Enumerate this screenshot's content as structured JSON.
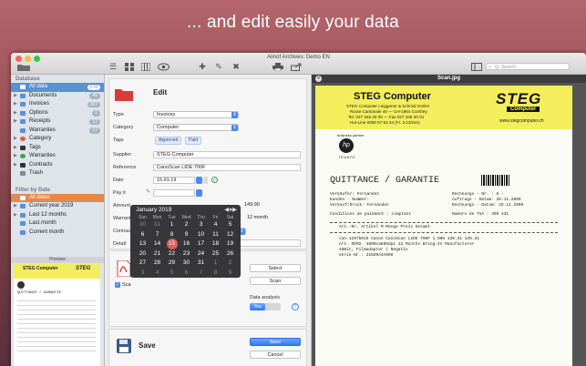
{
  "hero_text": "... and edit easily your data",
  "window": {
    "title": "Alinof Archives: Demo EN"
  },
  "toolbar": {
    "search_placeholder": "Q- Search"
  },
  "sidebar": {
    "database_title": "Database",
    "items": [
      {
        "label": "All data",
        "count": "278",
        "color": "#5b8fd6"
      },
      {
        "label": "Documents",
        "count": "45",
        "color": "#5b8fd6"
      },
      {
        "label": "Invoices",
        "count": "167",
        "color": "#5b8fd6"
      },
      {
        "label": "Options",
        "count": "1",
        "color": "#5b8fd6"
      },
      {
        "label": "Receipts",
        "count": "17",
        "color": "#5b8fd6"
      },
      {
        "label": "Warranties",
        "count": "17",
        "color": "#5b8fd6"
      },
      {
        "label": "Category",
        "count": "",
        "color": "#e25b3a"
      },
      {
        "label": "Tags",
        "count": "",
        "color": "#333"
      },
      {
        "label": "Warranties",
        "count": "",
        "color": "#38a24a"
      },
      {
        "label": "Contracts",
        "count": "",
        "color": "#333"
      },
      {
        "label": "Trash",
        "count": "",
        "color": "#888"
      }
    ],
    "filter_title": "Filter by Date",
    "filter_items": [
      "All dates",
      "Current year 2019",
      "Last 12 months",
      "Last month",
      "Current month"
    ],
    "preview_label": "Preview"
  },
  "edit": {
    "title": "Edit",
    "type_label": "Type",
    "type_value": "Invoices",
    "category_label": "Category",
    "category_value": "Computer",
    "tags_label": "Tags",
    "tags": [
      "Approved",
      "Paid"
    ],
    "supplier_label": "Supplier",
    "supplier_value": "STEG Computer",
    "reference_label": "Reference",
    "reference_value": "CanoScan LIDE 700F",
    "date_label": "Date",
    "date_value": "15.01.19",
    "payit_label": "Pay it",
    "amount_label": "Amount",
    "amount_value": "149.90",
    "warranty_label": "Warrant",
    "warranty_value": "12 month",
    "contract_label": "Contract",
    "detail_label": "Detail"
  },
  "calendar": {
    "month": "January 2019",
    "weekdays": [
      "Sun",
      "Mon",
      "Tue",
      "Wed",
      "Thu",
      "Fri",
      "Sat"
    ],
    "days": [
      [
        "30",
        "31",
        "1",
        "2",
        "3",
        "4",
        "5"
      ],
      [
        "6",
        "7",
        "8",
        "9",
        "10",
        "11",
        "12"
      ],
      [
        "13",
        "14",
        "15",
        "16",
        "17",
        "18",
        "19"
      ],
      [
        "20",
        "21",
        "22",
        "23",
        "24",
        "25",
        "26"
      ],
      [
        "27",
        "28",
        "29",
        "30",
        "31",
        "1",
        "2"
      ],
      [
        "3",
        "4",
        "5",
        "6",
        "7",
        "8",
        "9"
      ]
    ],
    "today": "15"
  },
  "attach": {
    "select_label": "Select",
    "scan_label": "Scan",
    "data_analysis_label": "Data analysis",
    "toggle_value": "Yes",
    "help": "?",
    "checkbox_label": "Sca"
  },
  "save_section": {
    "title": "Save",
    "save_button": "Save",
    "cancel_button": "Cancel"
  },
  "document": {
    "filename": "Scan.jpg",
    "company": "STEG Computer",
    "company_line1": "STEG Computer Leiggener & Schmid GmbH",
    "company_line2": "Route Cantonale 49 — CH-1964 Conthey",
    "company_line3": "Tel. 027 345 30 00 — Fax 027 345 30 01",
    "company_line4": "Hot-Line 0900 57 52 44 (Fr. 3.13/min)",
    "website": "www.stegcomputer.ch",
    "logo_text": "STEG",
    "logo_sub": "Computer",
    "partner": "business partner",
    "invent": "invent",
    "heading": "QUITTANCE / GARANTIE",
    "left_lines": [
      "Verkäufer: Fernandez",
      "Kunden - Nummer:",
      "Verkauf/Druck: Fernandez",
      "Conditions de paiement : comptant"
    ],
    "right_lines": [
      "Rechnungs - Nr. : 8 -",
      "Auftrags - Datum: 26.11.2009",
      "Rechnungs - Datum: 26.11.2009",
      "Numero de TVA : 399 431"
    ],
    "table_header": "Art.-Nr.     Artikel              M  Menge   Preis    Gesamt",
    "item_lines": [
      "can-1297b010  Canon CanoScan LIDE 700F   1.000   139.31   139.31",
      "              Art. OEM2. 4800x4800dpi     12 Months Bring-In Manufacturer",
      "              48Bit, Filmadapter | Negativ",
      "              Serie-Nr.: 21KD0A4A986"
    ]
  }
}
